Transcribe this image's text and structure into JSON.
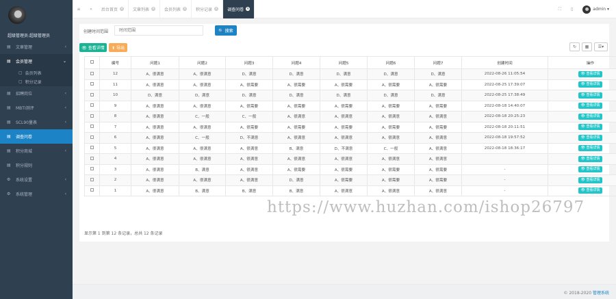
{
  "sidebar": {
    "profile_name": "超级管理员:超级管理员",
    "items": [
      {
        "label": "文章管理",
        "icon": "document-icon",
        "arrow": "‹"
      },
      {
        "label": "会员管理",
        "icon": "user-icon",
        "arrow": "⌄"
      },
      {
        "label": "招聘岗位",
        "icon": "briefcase-icon",
        "arrow": "‹"
      },
      {
        "label": "MBTI测评",
        "icon": "chart-icon",
        "arrow": "‹"
      },
      {
        "label": "SCL90量表",
        "icon": "list-icon",
        "arrow": "‹"
      },
      {
        "label": "调查问卷",
        "icon": "survey-icon",
        "arrow": ""
      },
      {
        "label": "积分商城",
        "icon": "cart-icon",
        "arrow": "‹"
      },
      {
        "label": "积分规则",
        "icon": "rule-icon",
        "arrow": ""
      },
      {
        "label": "系统设置",
        "icon": "gear-icon",
        "arrow": "‹"
      },
      {
        "label": "系统管理",
        "icon": "settings-icon",
        "arrow": "‹"
      }
    ],
    "subitems": [
      {
        "label": "会员列表"
      },
      {
        "label": "积分记录"
      }
    ]
  },
  "topbar": {
    "tabs": [
      {
        "label": "后台首页"
      },
      {
        "label": "文章列表"
      },
      {
        "label": "会员列表"
      },
      {
        "label": "积分记录"
      },
      {
        "label": "调查问卷"
      }
    ],
    "user": "admin ▾"
  },
  "search": {
    "label": "创建时间范围",
    "placeholder": "时间范围",
    "button": "🔍 搜索"
  },
  "toolbar": {
    "detail_button": "👁 查看详情",
    "export_button": "⬆ 导出"
  },
  "table": {
    "headers": [
      "编号",
      "问题1",
      "问题2",
      "问题3",
      "问题4",
      "问题5",
      "问题6",
      "问题7",
      "创建时间",
      "操作"
    ],
    "action_label": "👁 查看详情",
    "rows": [
      [
        "12",
        "A、很满意",
        "A、很满意",
        "D、满意",
        "D、满意",
        "D、满意",
        "D、满意",
        "D、满意",
        "2022-08-26 11:05:54"
      ],
      [
        "11",
        "A、很满意",
        "A、很满意",
        "A、很需要",
        "A、很需要",
        "A、很需要",
        "A、很需要",
        "A、很需要",
        "2022-08-25 17:39:07"
      ],
      [
        "10",
        "D、满意",
        "D、满意",
        "D、满意",
        "D、满意",
        "D、满意",
        "D、满意",
        "D、满意",
        "2022-08-25 17:38:49"
      ],
      [
        "9",
        "A、很满意",
        "A、很满意",
        "A、很需要",
        "A、很需要",
        "A、很需要",
        "A、很需要",
        "A、很需要",
        "2022-08-18 14:40:07"
      ],
      [
        "8",
        "A、很满意",
        "C、一般",
        "C、一般",
        "A、很满意",
        "A、很满意",
        "A、很满意",
        "A、很满意",
        "2022-08-18 20:25:23"
      ],
      [
        "7",
        "A、很满意",
        "A、很满意",
        "A、很需要",
        "A、很需要",
        "A、很需要",
        "A、很需要",
        "A、很需要",
        "2022-08-18 20:11:51"
      ],
      [
        "6",
        "A、很满意",
        "C、一般",
        "D、不满意",
        "A、很满意",
        "A、很满意",
        "A、很满意",
        "A、很满意",
        "2022-08-18 19:57:52"
      ],
      [
        "5",
        "A、很满意",
        "A、很满意",
        "A、很满意",
        "B、满意",
        "D、不满意",
        "C、一般",
        "A、很满意",
        "2022-08-18 18:36:17"
      ],
      [
        "4",
        "A、很满意",
        "A、很满意",
        "A、很满意",
        "A、很满意",
        "A、很满意",
        "A、很满意",
        "A、很满意",
        ""
      ],
      [
        "3",
        "A、很满意",
        "B、满意",
        "A、很满意",
        "A、很需要",
        "A、很需要",
        "A、很需要",
        "A、很需要",
        "-"
      ],
      [
        "2",
        "A、很满意",
        "A、很满意",
        "A、很满意",
        "D、满意",
        "A、很需要",
        "A、很需要",
        "A、很需要",
        "-"
      ],
      [
        "1",
        "A、很满意",
        "B、满意",
        "B、满意",
        "B、满意",
        "A、很满意",
        "A、很满意",
        "A、很满意",
        "-"
      ]
    ],
    "footer": "显示第 1 到第 12 条记录，总共 12 条记录"
  },
  "watermark": "https://www.huzhan.com/ishop26797",
  "copyright": {
    "prefix": "© 2018-2020 ",
    "brand": "管理系统"
  },
  "colors": {
    "sidebar": "#2f4050",
    "primary": "#1c84c6",
    "success": "#1ab394",
    "warning": "#f8ac59",
    "info": "#23c6c8"
  }
}
